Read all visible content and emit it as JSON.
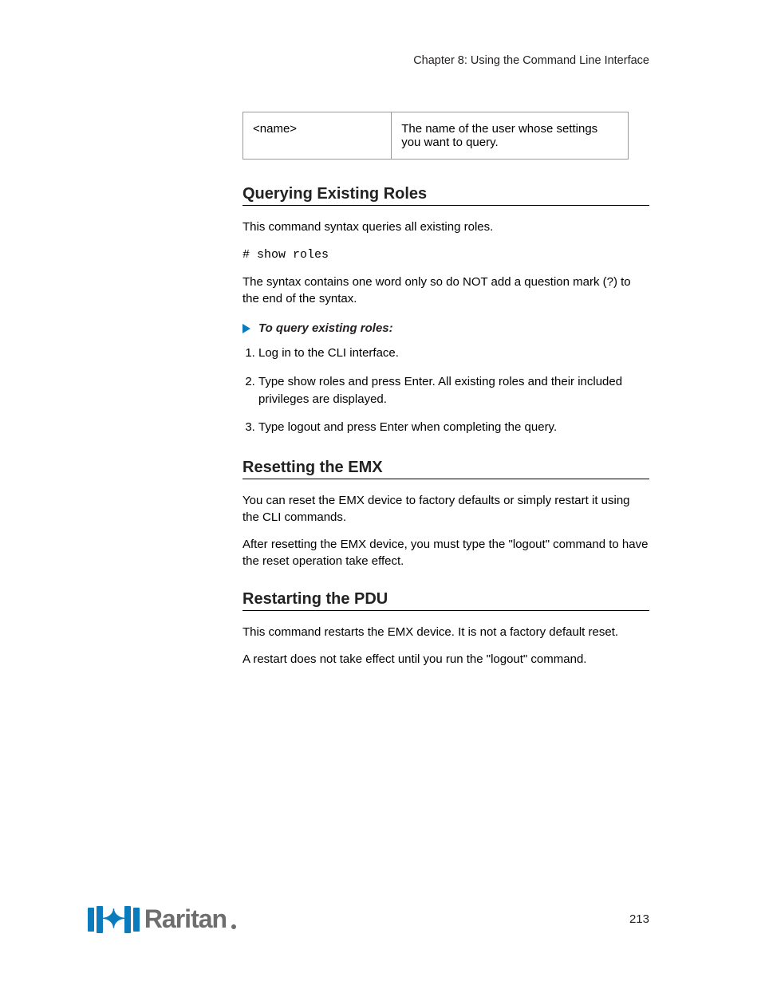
{
  "header": {
    "running_title": "Chapter 8: Using the Command Line Interface"
  },
  "table": {
    "row": {
      "variable": "<name>",
      "description": "The name of the user whose settings you want to query."
    }
  },
  "sections": [
    {
      "title": "Querying Existing Roles",
      "paragraphs": [
        "This command syntax queries all existing roles.",
        "The syntax contains one word only so do NOT add a question mark (?) to the end of the syntax."
      ],
      "command": "# show roles",
      "procedure": {
        "heading": "To query existing roles:",
        "steps": [
          "Log in to the CLI interface.",
          "Type show roles and press Enter. All existing roles and their included privileges are displayed.",
          "Type logout and press Enter when completing the query."
        ]
      }
    },
    {
      "title": "Resetting the EMX",
      "paragraphs": [
        "You can reset the EMX device to factory defaults or simply restart it using the CLI commands.",
        "After resetting the EMX device, you must type the \"logout\" command to have the reset operation take effect."
      ]
    },
    {
      "title": "Restarting the PDU",
      "paragraphs": [
        "This command restarts the EMX device. It is not a factory default reset.",
        "A restart does not take effect until you run the \"logout\" command."
      ]
    }
  ],
  "footer": {
    "logo_text": "Raritan",
    "page_number": "213"
  }
}
